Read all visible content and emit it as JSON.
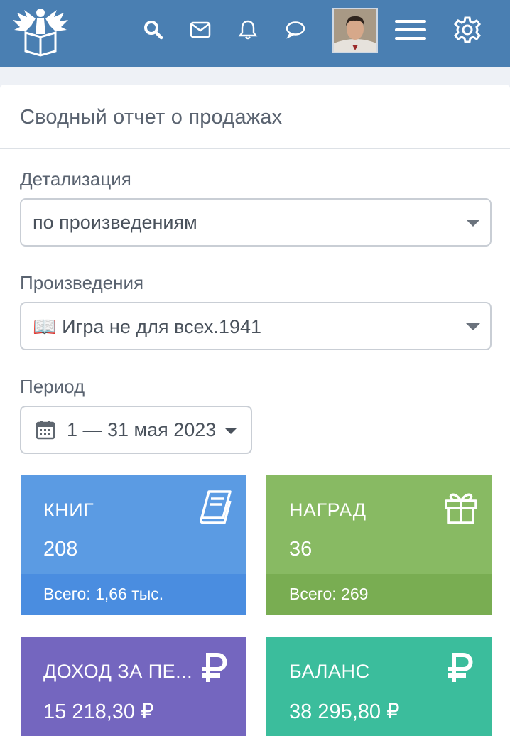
{
  "header": {
    "icons": [
      "logo-eagle",
      "search-icon",
      "mail-icon",
      "bell-icon",
      "chat-icon",
      "avatar",
      "menu-icon",
      "gear-icon"
    ]
  },
  "report": {
    "title": "Сводный отчет о продажах",
    "detail_label": "Детализация",
    "detail_value": "по произведениям",
    "works_label": "Произведения",
    "works_value": "📖 Игра не для всех.1941",
    "period_label": "Период",
    "period_value": "1 — 31 мая 2023"
  },
  "tiles": {
    "books": {
      "label": "КНИГ",
      "value": "208",
      "footer": "Всего: 1,66 тыс.",
      "color": "#5b9be3",
      "footer_color": "#4a8de0"
    },
    "awards": {
      "label": "НАГРАД",
      "value": "36",
      "footer": "Всего: 269",
      "color": "#88ba63",
      "footer_color": "#79ad52"
    },
    "income": {
      "label": "ДОХОД ЗА ПЕ...",
      "value": "15 218,30 ₽",
      "color": "#7466bf"
    },
    "balance": {
      "label": "БАЛАНС",
      "value": "38 295,80 ₽",
      "color": "#3bbd9c"
    }
  }
}
